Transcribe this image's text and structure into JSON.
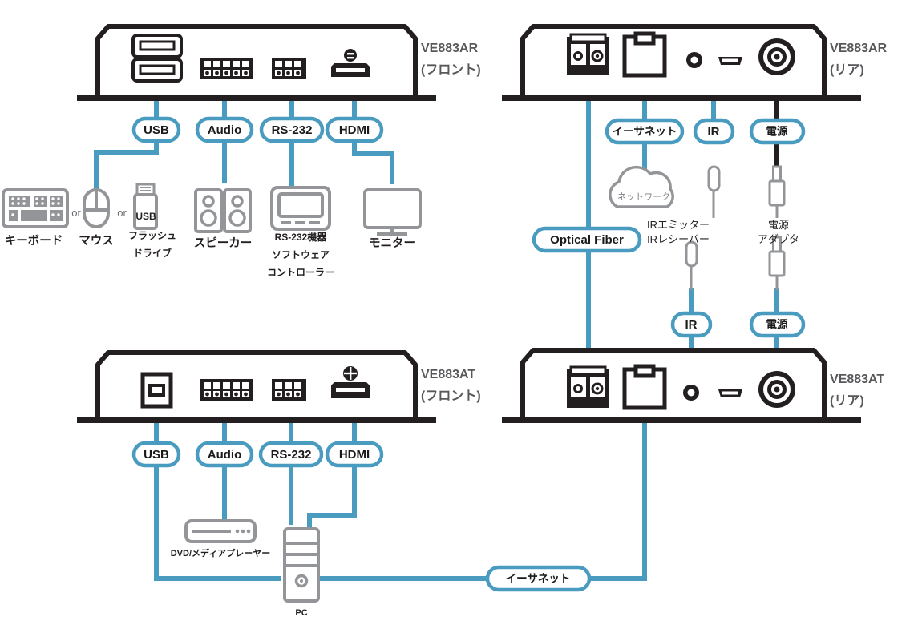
{
  "meta": {
    "title": "VE883AR / VE883AT 接続図",
    "colors": {
      "accent_blue": "#4a9bc0",
      "device_outline": "#231f20",
      "peripheral_gray": "#939598",
      "label_gray": "#58585b",
      "background": "#ffffff"
    }
  },
  "devices": [
    {
      "id": "ve883ar-front",
      "model": "VE883AR",
      "view": "(フロント)",
      "ports": [
        "usb-a-dual-port",
        "audio-terminal-block-port",
        "rs232-terminal-block-port",
        "hdmi-port"
      ]
    },
    {
      "id": "ve883ar-rear",
      "model": "VE883AR",
      "view": "(リア)",
      "ports": [
        "sfp-fiber-port",
        "rj45-ethernet-port",
        "ir-jack-port",
        "micro-usb-port",
        "dc-power-jack-port"
      ]
    },
    {
      "id": "ve883at-front",
      "model": "VE883AT",
      "view": "(フロント)",
      "ports": [
        "usb-b-port",
        "audio-terminal-block-port",
        "rs232-terminal-block-port",
        "hdmi-port"
      ]
    },
    {
      "id": "ve883at-rear",
      "model": "VE883AT",
      "view": "(リア)",
      "ports": [
        "sfp-fiber-port",
        "rj45-ethernet-port",
        "ir-jack-port",
        "micro-usb-port",
        "dc-power-jack-port"
      ]
    }
  ],
  "connection_labels": {
    "top_left": [
      {
        "id": "usb-top",
        "text": "USB"
      },
      {
        "id": "audio-top",
        "text": "Audio"
      },
      {
        "id": "rs232-top",
        "text": "RS-232"
      },
      {
        "id": "hdmi-top",
        "text": "HDMI"
      }
    ],
    "top_right": [
      {
        "id": "ethernet-top",
        "text": "イーサネット"
      },
      {
        "id": "ir-top",
        "text": "IR"
      },
      {
        "id": "power-top",
        "text": "電源"
      }
    ],
    "middle_right": [
      {
        "id": "optical-fiber",
        "text": "Optical Fiber"
      },
      {
        "id": "ir-bottom",
        "text": "IR"
      },
      {
        "id": "power-bottom",
        "text": "電源"
      }
    ],
    "bottom_left": [
      {
        "id": "usb-bottom",
        "text": "USB"
      },
      {
        "id": "audio-bottom",
        "text": "Audio"
      },
      {
        "id": "rs232-bottom",
        "text": "RS-232"
      },
      {
        "id": "hdmi-bottom",
        "text": "HDMI"
      }
    ],
    "bottom_right": [
      {
        "id": "ethernet-bottom",
        "text": "イーサネット"
      }
    ]
  },
  "peripherals": {
    "keyboard": {
      "label": "キーボード"
    },
    "mouse": {
      "label": "マウス"
    },
    "usb_flash": {
      "label_line1": "USB",
      "label_line2": "フラッシュ",
      "label_line3": "ドライブ"
    },
    "speaker": {
      "label": "スピーカー"
    },
    "rs232_device": {
      "label_line1": "RS-232機器",
      "label_line2": "ソフトウェア",
      "label_line3": "コントローラー"
    },
    "monitor": {
      "label": "モニター"
    },
    "dvd_player": {
      "label": "DVD/メディアプレーヤー"
    },
    "pc": {
      "label": "PC"
    },
    "network_cloud": {
      "label": "ネットワーク"
    },
    "or_1": {
      "text": "or"
    },
    "or_2": {
      "text": "or"
    }
  },
  "annotations": {
    "ir_emitter_receiver": {
      "line1": "IRエミッター",
      "line2": "IRレシーバー"
    },
    "power_adapter": {
      "line1": "電源",
      "line2": "アダプタ"
    }
  }
}
